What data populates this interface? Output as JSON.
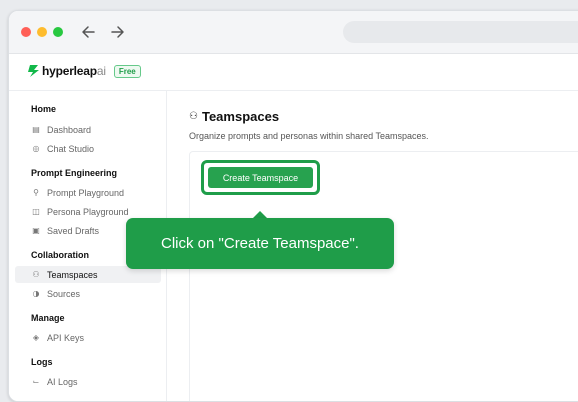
{
  "brand": {
    "name": "hyperleap",
    "suffix": "ai",
    "plan_badge": "Free",
    "accent": "#1f9d49"
  },
  "sidebar": {
    "sections": [
      {
        "title": "Home",
        "items": [
          {
            "label": "Dashboard",
            "icon": "dashboard-icon"
          },
          {
            "label": "Chat Studio",
            "icon": "chat-icon"
          }
        ]
      },
      {
        "title": "Prompt Engineering",
        "items": [
          {
            "label": "Prompt Playground",
            "icon": "wand-icon"
          },
          {
            "label": "Persona Playground",
            "icon": "persona-icon"
          },
          {
            "label": "Saved Drafts",
            "icon": "drafts-icon"
          }
        ]
      },
      {
        "title": "Collaboration",
        "items": [
          {
            "label": "Teamspaces",
            "icon": "users-icon",
            "active": true
          },
          {
            "label": "Sources",
            "icon": "sources-icon"
          }
        ]
      },
      {
        "title": "Manage",
        "items": [
          {
            "label": "API Keys",
            "icon": "shield-icon"
          }
        ]
      },
      {
        "title": "Logs",
        "items": [
          {
            "label": "AI Logs",
            "icon": "chart-icon"
          }
        ]
      }
    ]
  },
  "main": {
    "title": "Teamspaces",
    "subtitle": "Organize prompts and personas within shared Teamspaces.",
    "create_button": "Create Teamspace"
  },
  "tooltip": {
    "text": "Click on \"Create Teamspace\"."
  }
}
